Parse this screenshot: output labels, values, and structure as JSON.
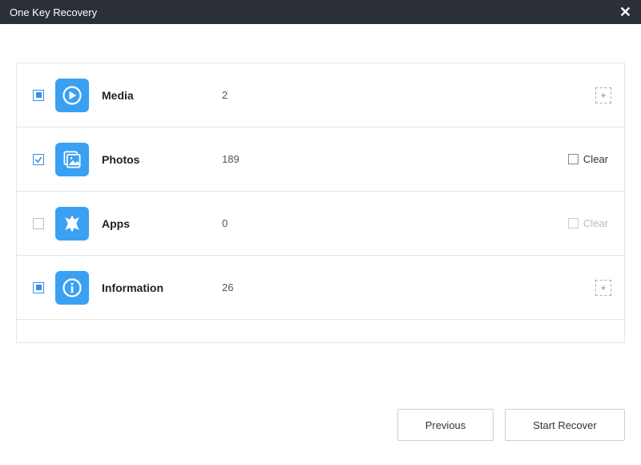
{
  "window": {
    "title": "One Key Recovery"
  },
  "categories": [
    {
      "icon": "media",
      "label": "Media",
      "count": "2",
      "checkbox": "filled",
      "action": "expand",
      "clear_label": ""
    },
    {
      "icon": "photos",
      "label": "Photos",
      "count": "189",
      "checkbox": "check",
      "action": "clear",
      "clear_label": "Clear",
      "clear_disabled": false
    },
    {
      "icon": "apps",
      "label": "Apps",
      "count": "0",
      "checkbox": "empty",
      "action": "clear",
      "clear_label": "Clear",
      "clear_disabled": true
    },
    {
      "icon": "info",
      "label": "Information",
      "count": "26",
      "checkbox": "filled",
      "action": "expand",
      "clear_label": ""
    }
  ],
  "buttons": {
    "previous": "Previous",
    "start_recover": "Start Recover"
  }
}
